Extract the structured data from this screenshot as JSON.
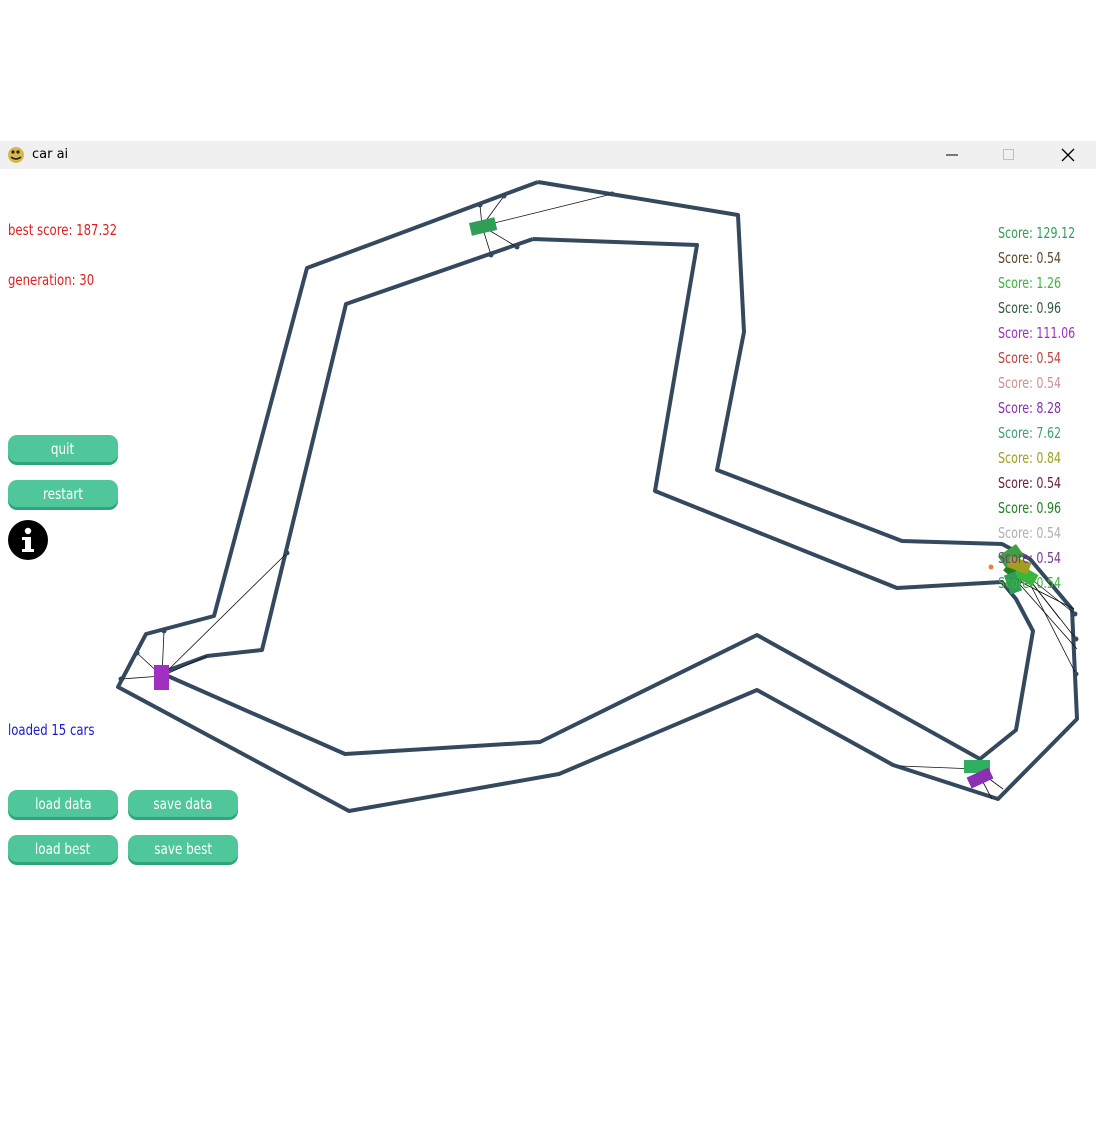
{
  "window": {
    "title": "car ai",
    "controls": [
      "minimize",
      "maximize",
      "close"
    ]
  },
  "hud": {
    "best_score": "best score: 187.32",
    "generation": "generation: 30",
    "status": "loaded 15 cars",
    "best_score_color": "#e02020",
    "status_color": "#1818d8"
  },
  "buttons": {
    "quit": "quit",
    "restart": "restart",
    "load_data": "load data",
    "save_data": "save data",
    "load_best": "load best",
    "save_best": "save best",
    "info_icon": "info-icon",
    "color": "#4fc79a"
  },
  "scores": [
    {
      "text": "Score: 129.12",
      "color": "#2f9e57"
    },
    {
      "text": "Score: 0.54",
      "color": "#5a4a2a"
    },
    {
      "text": "Score: 1.26",
      "color": "#3bb53b"
    },
    {
      "text": "Score: 0.96",
      "color": "#2f5a3a"
    },
    {
      "text": "Score: 111.06",
      "color": "#a030c0"
    },
    {
      "text": "Score: 0.54",
      "color": "#c04040"
    },
    {
      "text": "Score: 0.54",
      "color": "#d09090"
    },
    {
      "text": "Score: 8.28",
      "color": "#8a30b0"
    },
    {
      "text": "Score: 7.62",
      "color": "#40a070"
    },
    {
      "text": "Score: 0.84",
      "color": "#a0a020"
    },
    {
      "text": "Score: 0.54",
      "color": "#6a2040"
    },
    {
      "text": "Score: 0.96",
      "color": "#208020"
    },
    {
      "text": "Score: 0.54",
      "color": "#b0b0b0"
    },
    {
      "text": "Score: 0.54",
      "color": "#7a3a8a"
    },
    {
      "text": "Score: 0.54",
      "color": "#40b040"
    }
  ],
  "track_color": "#34495e"
}
